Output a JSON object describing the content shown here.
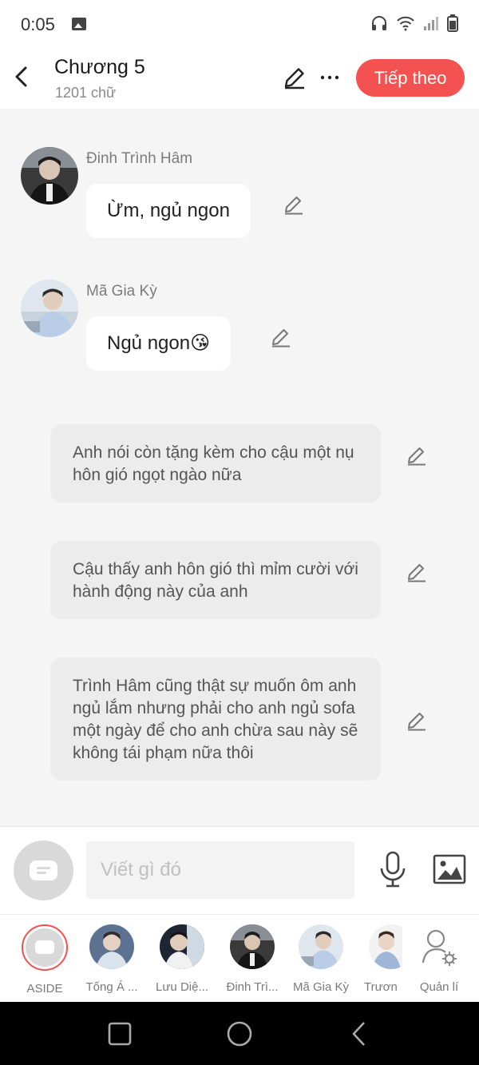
{
  "status_bar": {
    "time": "0:05"
  },
  "header": {
    "title": "Chương 5",
    "subtitle": "1201 chữ",
    "next_label": "Tiếp theo"
  },
  "messages": [
    {
      "sender": "Đinh Trình Hâm",
      "text": "Ừm, ngủ ngon"
    },
    {
      "sender": "Mã Gia Kỳ",
      "text": "Ngủ ngon😘"
    }
  ],
  "narrations": [
    "Anh nói còn tặng kèm cho cậu một nụ hôn gió ngọt ngào nữa",
    "Cậu thấy anh hôn gió thì mỉm cười với hành động này của anh",
    "Trình Hâm cũng thật sự muốn ôm anh ngủ lắm nhưng phải cho anh ngủ sofa một ngày để cho anh chừa sau này sẽ không tái phạm nữa thôi"
  ],
  "composer": {
    "placeholder": "Viết gì đó"
  },
  "characters": [
    {
      "label": "ASIDE"
    },
    {
      "label": "Tống Á ..."
    },
    {
      "label": "Lưu Diệ..."
    },
    {
      "label": "Đinh Trì..."
    },
    {
      "label": "Mã Gia Kỳ"
    },
    {
      "label": "Trươn"
    },
    {
      "label": "Quản lí"
    }
  ],
  "colors": {
    "accent": "#f45151",
    "chat_bg": "#f5f5f5",
    "bubble": "#ffffff",
    "narration": "#ececec"
  }
}
